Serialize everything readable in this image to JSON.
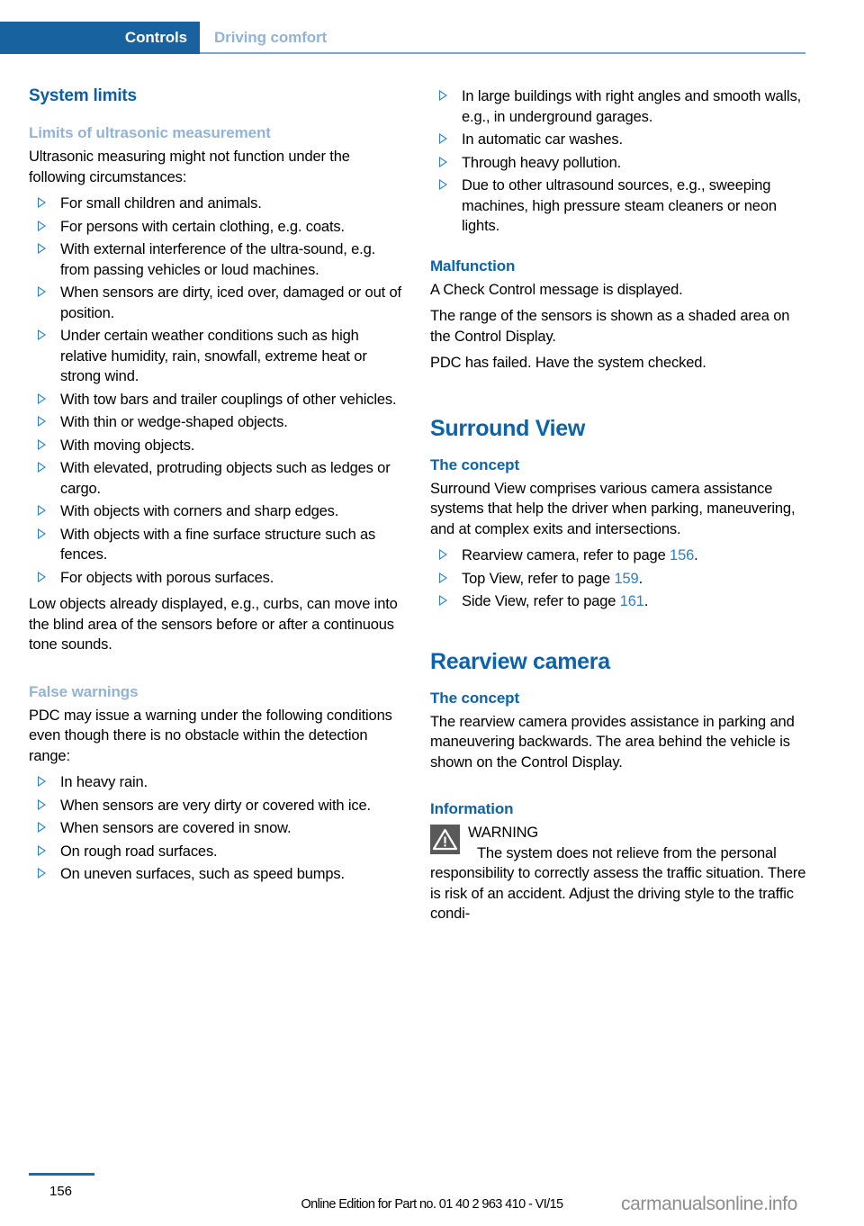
{
  "header": {
    "active_tab": "Controls",
    "inactive_tab": "Driving comfort",
    "accent_color": "#17629f",
    "inactive_color": "#93b3d6"
  },
  "left_column": {
    "section_title": "System limits",
    "subsection_1_title": "Limits of ultrasonic measurement",
    "intro_paragraph": "Ultrasonic measuring might not function under the following circumstances:",
    "bullets_1": [
      "For small children and animals.",
      "For persons with certain clothing, e.g. coats.",
      "With external interference of the ultra-sound, e.g. from passing vehicles or loud machines.",
      "When sensors are dirty, iced over, damaged or out of position.",
      "Under certain weather conditions such as high relative humidity, rain, snowfall, extreme heat or strong wind.",
      "With tow bars and trailer couplings of other vehicles.",
      "With thin or wedge-shaped objects.",
      "With moving objects.",
      "With elevated, protruding objects such as ledges or cargo.",
      "With objects with corners and sharp edges.",
      "With objects with a fine surface structure such as fences.",
      "For objects with porous surfaces."
    ],
    "closing_paragraph": "Low objects already displayed, e.g., curbs, can move into the blind area of the sensors before or after a continuous tone sounds.",
    "subsection_2_title": "False warnings",
    "false_warnings_intro": "PDC may issue a warning under the following conditions even though there is no obstacle within the detection range:",
    "bullets_2": [
      "In heavy rain.",
      "When sensors are very dirty or covered with ice.",
      "When sensors are covered in snow.",
      "On rough road surfaces.",
      "On uneven surfaces, such as speed bumps."
    ]
  },
  "right_column": {
    "bullets_continued": [
      "In large buildings with right angles and smooth walls, e.g., in underground garages.",
      "In automatic car washes.",
      "Through heavy pollution.",
      "Due to other ultrasound sources, e.g., sweeping machines, high pressure steam cleaners or neon lights."
    ],
    "malfunction_title": "Malfunction",
    "malfunction_paragraphs": [
      "A Check Control message is displayed.",
      "The range of the sensors is shown as a shaded area on the Control Display.",
      "PDC has failed. Have the system checked."
    ],
    "surround_view_title": "Surround View",
    "surround_view_concept_title": "The concept",
    "surround_view_concept_paragraph": "Surround View comprises various camera assistance systems that help the driver when parking, maneuvering, and at complex exits and intersections.",
    "surround_view_links": [
      {
        "text_before": "Rearview camera, refer to page ",
        "page": "156",
        "text_after": "."
      },
      {
        "text_before": "Top View, refer to page ",
        "page": "159",
        "text_after": "."
      },
      {
        "text_before": "Side View, refer to page ",
        "page": "161",
        "text_after": "."
      }
    ],
    "rearview_title": "Rearview camera",
    "rearview_concept_title": "The concept",
    "rearview_concept_paragraph": "The rearview camera provides assistance in parking and maneuvering backwards. The area behind the vehicle is shown on the Control Display.",
    "information_title": "Information",
    "warning_label": "WARNING",
    "warning_text": "The system does not relieve from the personal responsibility to correctly assess the traffic situation. There is risk of an accident. Adjust the driving style to the traffic condi-",
    "warning_icon_color": "#595959",
    "link_color": "#2a7fd0"
  },
  "footer": {
    "page_number": "156",
    "edition_note": "Online Edition for Part no. 01 40 2 963 410 - VI/15",
    "watermark": "carmanualsonline.info"
  }
}
